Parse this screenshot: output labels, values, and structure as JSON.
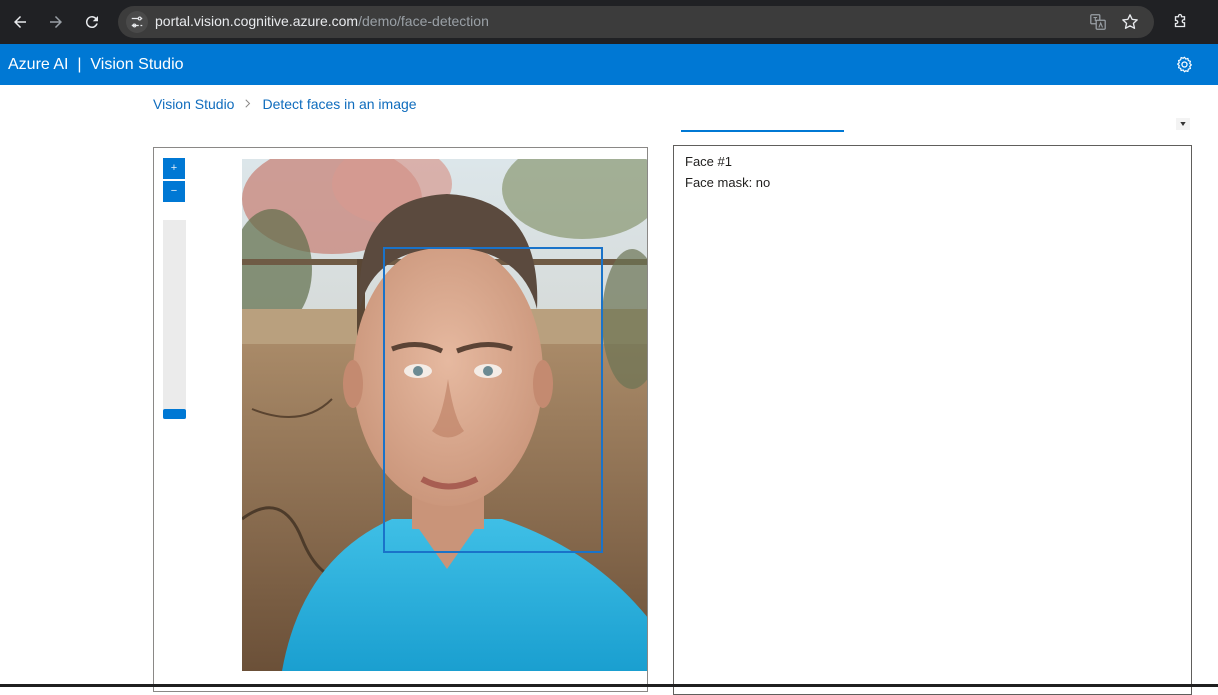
{
  "browser": {
    "url_domain": "portal.vision.cognitive.azure.com",
    "url_path": "/demo/face-detection"
  },
  "app": {
    "title": "Azure AI  |  Vision Studio"
  },
  "breadcrumb": {
    "items": [
      {
        "label": "Vision Studio"
      },
      {
        "label": "Detect faces in an image"
      }
    ],
    "separator": ">"
  },
  "image_panel": {
    "zoom_in_label": "+",
    "zoom_out_label": "−"
  },
  "results": {
    "lines": [
      "Face #1",
      "Face mask: no"
    ]
  },
  "colors": {
    "accent": "#0078d4",
    "chrome": "#202124",
    "face_box": "#1a73c9"
  }
}
